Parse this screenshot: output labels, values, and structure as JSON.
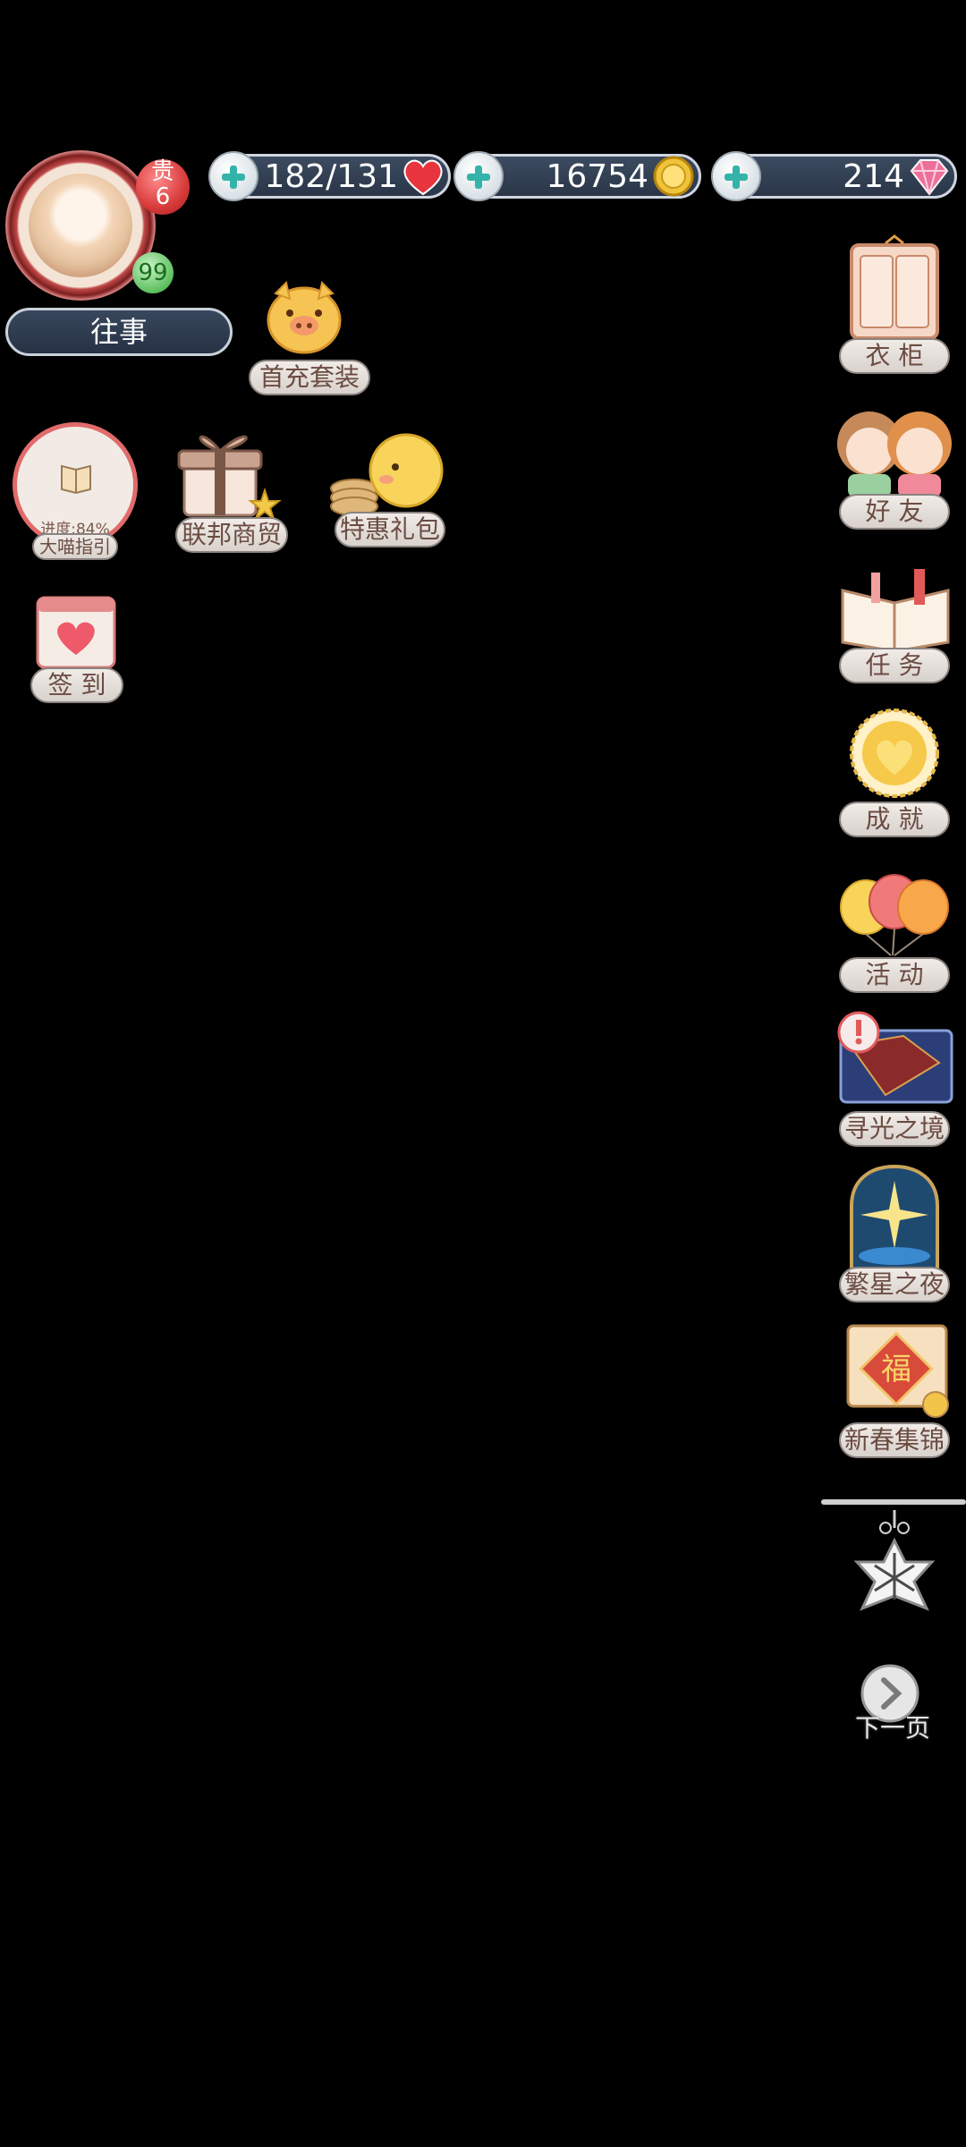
{
  "resources": {
    "stamina": {
      "value": "182/131",
      "icon": "heart-icon",
      "color": "#e8343c"
    },
    "gold": {
      "value": "16754",
      "icon": "gold-coin-icon",
      "color": "#f0c43a"
    },
    "diamond": {
      "value": "214",
      "icon": "diamond-icon",
      "color": "#ef6f9b"
    }
  },
  "profile": {
    "noble_label": "贵",
    "noble_level": "6",
    "level": "99",
    "memories_button": "往事"
  },
  "left_menu": {
    "first_recharge": "首充套装",
    "guide_progress": "进度:84%",
    "guide_label": "大喵指引",
    "federation_trade": "联邦商贸",
    "special_pack": "特惠礼包",
    "check_in": "签 到"
  },
  "right_menu": {
    "wardrobe": "衣 柜",
    "friends": "好 友",
    "tasks": "任 务",
    "achievements": "成 就",
    "events": "活 动",
    "light_mirror": "寻光之境",
    "starry_night": "繁星之夜",
    "spring_collection": "新春集锦",
    "next_page": "下一页"
  },
  "colors": {
    "accent_red": "#e16b6b",
    "pill_bg": "#e8e2dd",
    "dark_pill": "#2e3a4c"
  }
}
